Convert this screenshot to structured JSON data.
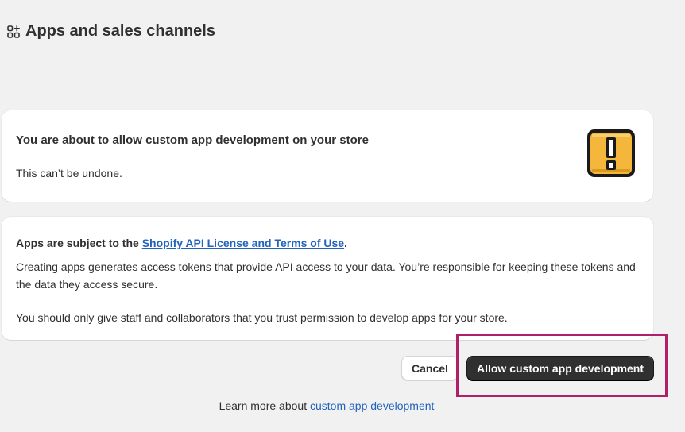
{
  "header": {
    "title": "Apps and sales channels",
    "icon": "apps-icon"
  },
  "notice_card": {
    "heading": "You are about to allow custom app development on your store",
    "subtext": "This can’t be undone.",
    "icon": "warning-exclamation-icon",
    "icon_color": "#f5b73b"
  },
  "terms_card": {
    "intro_prefix": "Apps are subject to the ",
    "intro_link": "Shopify API License and Terms of Use",
    "intro_suffix": ".",
    "paragraph_tokens": "Creating apps generates access tokens that provide API access to your data. You’re responsible for keeping these tokens and the data they access secure.",
    "paragraph_staff": "You should only give staff and collaborators that you trust permission to develop apps for your store."
  },
  "actions": {
    "cancel_label": "Cancel",
    "allow_label": "Allow custom app development"
  },
  "footer": {
    "prefix": "Learn more about ",
    "link": "custom app development"
  },
  "colors": {
    "background": "#f1f1f1",
    "primary_button": "#303030",
    "link": "#2463bc",
    "highlight_outline": "#b0206a"
  }
}
